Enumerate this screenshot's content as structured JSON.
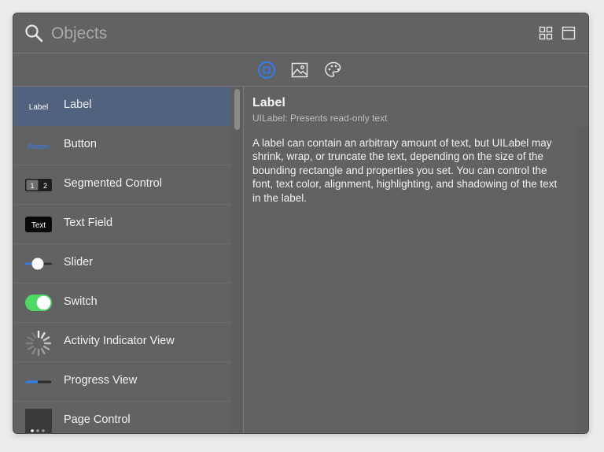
{
  "search": {
    "placeholder": "Objects",
    "value": ""
  },
  "header": {
    "grid_view_icon": "grid-view-icon",
    "panel_view_icon": "panel-view-icon"
  },
  "tabs": [
    {
      "icon": "object-library-icon",
      "selected": true
    },
    {
      "icon": "image-library-icon",
      "selected": false
    },
    {
      "icon": "color-palette-icon",
      "selected": false
    }
  ],
  "list": {
    "items": [
      {
        "label": "Label",
        "icon_text": "Label",
        "selected": true
      },
      {
        "label": "Button",
        "icon_text": "Button"
      },
      {
        "label": "Segmented Control",
        "icon_text_1": "1",
        "icon_text_2": "2"
      },
      {
        "label": "Text Field",
        "icon_text": "Text"
      },
      {
        "label": "Slider"
      },
      {
        "label": "Switch"
      },
      {
        "label": "Activity Indicator View"
      },
      {
        "label": "Progress View"
      },
      {
        "label": "Page Control"
      }
    ]
  },
  "detail": {
    "title": "Label",
    "subtitle": "UILabel: Presents read-only text",
    "description": "A label can contain an arbitrary amount of text, but UILabel may shrink, wrap, or truncate the text, depending on the size of the bounding rectangle and properties you set. You can control the font, text color, alignment, highlighting, and shadowing of the text in the label."
  },
  "colors": {
    "accent": "#2f7ef6",
    "selection": "#51627f",
    "switch_on": "#4cd964",
    "background": "#626262"
  }
}
